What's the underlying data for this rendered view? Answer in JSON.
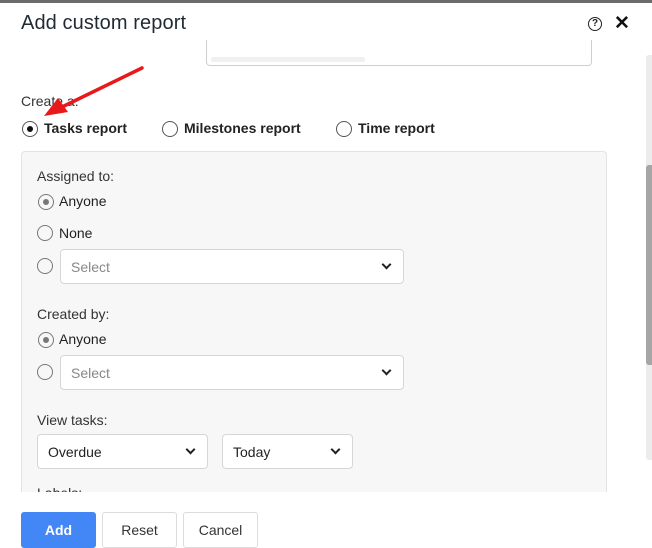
{
  "dialog": {
    "title": "Add custom report",
    "help_icon": "help-circle-icon",
    "close_icon": "close-icon",
    "help_glyph": "?",
    "close_glyph": "✕"
  },
  "create": {
    "label": "Create a:",
    "options": [
      {
        "label": "Tasks report",
        "checked": true
      },
      {
        "label": "Milestones report",
        "checked": false
      },
      {
        "label": "Time report",
        "checked": false
      }
    ]
  },
  "assigned_to": {
    "label": "Assigned to:",
    "options": [
      {
        "label": "Anyone",
        "checked": true
      },
      {
        "label": "None",
        "checked": false
      }
    ],
    "select_placeholder": "Select"
  },
  "created_by": {
    "label": "Created by:",
    "options": [
      {
        "label": "Anyone",
        "checked": true
      }
    ],
    "select_placeholder": "Select"
  },
  "view_tasks": {
    "label": "View tasks:",
    "status_value": "Overdue",
    "date_value": "Today"
  },
  "labels_section": {
    "label": "Labels:"
  },
  "footer": {
    "add_label": "Add",
    "reset_label": "Reset",
    "cancel_label": "Cancel"
  },
  "annotation": {
    "arrow_color": "#e8191a"
  },
  "colors": {
    "primary": "#4287f5"
  }
}
